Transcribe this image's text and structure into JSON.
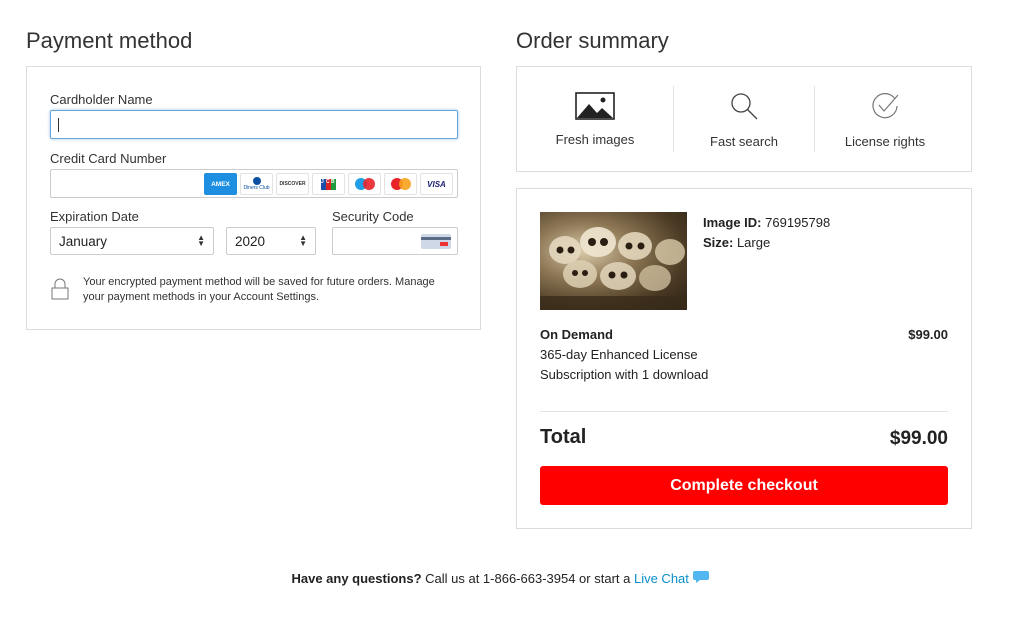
{
  "payment": {
    "title": "Payment method",
    "cardholder_label": "Cardholder Name",
    "cardholder_value": "",
    "card_number_label": "Credit Card Number",
    "card_number_value": "",
    "card_logos": [
      "AMEX",
      "Diners Club",
      "DISCOVER",
      "JCB",
      "Maestro",
      "Mastercard",
      "VISA"
    ],
    "expiration_label": "Expiration Date",
    "month_value": "January",
    "year_value": "2020",
    "security_label": "Security Code",
    "security_value": "",
    "save_notice_line1": "Your encrypted payment method will be saved for future orders. Manage",
    "save_notice_line2": "your payment methods in your Account Settings."
  },
  "summary": {
    "title": "Order summary",
    "features": [
      {
        "label": "Fresh images",
        "icon": "image-icon"
      },
      {
        "label": "Fast search",
        "icon": "search-icon"
      },
      {
        "label": "License rights",
        "icon": "check-circle-icon"
      }
    ],
    "image_id_label": "Image ID:",
    "image_id_value": " 769195798",
    "size_label": "Size:",
    "size_value": " Large",
    "plan_name": "On Demand",
    "plan_price": "$99.00",
    "plan_license": "365-day Enhanced License",
    "plan_downloads": "Subscription with 1 download",
    "total_label": "Total",
    "total_value": "$99.00",
    "checkout_label": "Complete checkout"
  },
  "footer": {
    "question": "Have any questions?",
    "call_text": " Call us at 1-866-663-3954 or start a ",
    "live_chat": "Live Chat"
  },
  "colors": {
    "accent_red": "#ff0000",
    "link_blue": "#0a8fc9",
    "focus_blue": "#6aa5d8"
  }
}
